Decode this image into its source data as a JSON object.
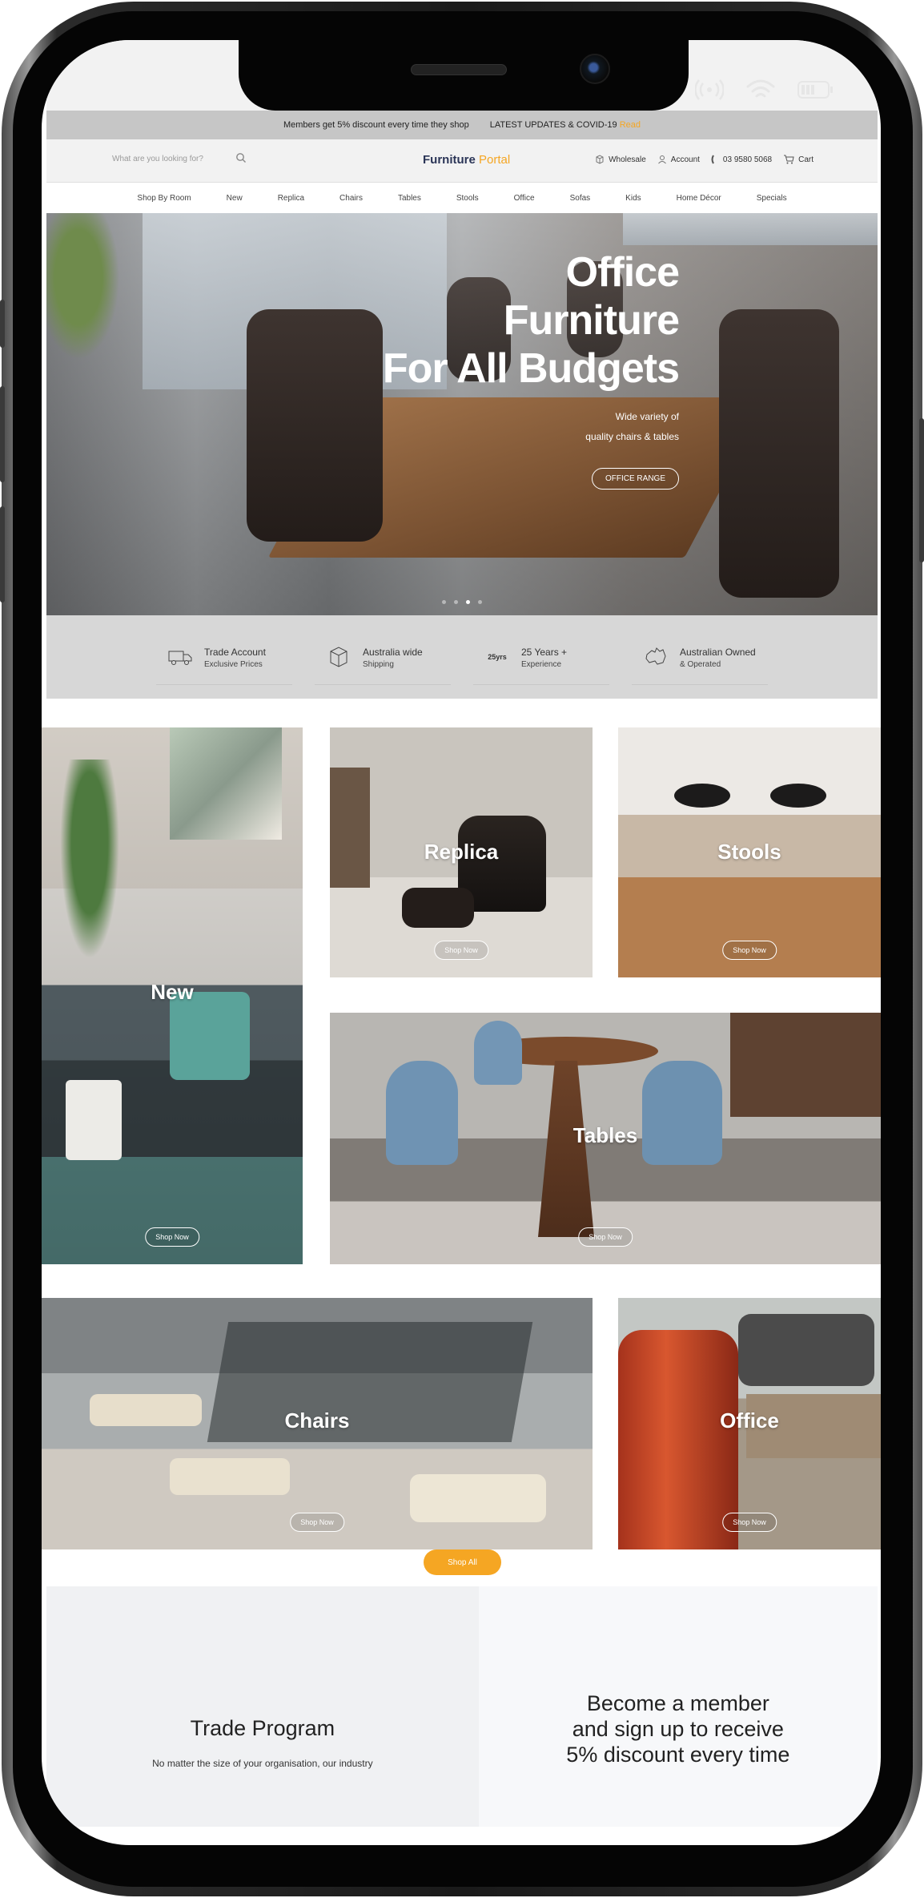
{
  "announcement": {
    "discount_text": "Members get 5% discount every time they shop",
    "updates_text": "LATEST UPDATES & COVID-19",
    "updates_link": "Read"
  },
  "header": {
    "search_placeholder": "What are you looking for?",
    "logo_main": "Furniture",
    "logo_accent": "Portal",
    "wholesale": "Wholesale",
    "account": "Account",
    "phone": "03 9580 5068",
    "cart": "Cart"
  },
  "nav": [
    "Shop By Room",
    "New",
    "Replica",
    "Chairs",
    "Tables",
    "Stools",
    "Office",
    "Sofas",
    "Kids",
    "Home Décor",
    "Specials"
  ],
  "hero": {
    "title_line1": "Office",
    "title_line2": "Furniture",
    "title_line3": "For All Budgets",
    "sub_line1": "Wide variety of",
    "sub_line2": "quality chairs & tables",
    "button": "OFFICE RANGE",
    "slides": 4,
    "active_slide": 3
  },
  "features": [
    {
      "title": "Trade Account",
      "subtitle": "Exclusive Prices",
      "icon": "van-icon"
    },
    {
      "title": "Australia wide",
      "subtitle": "Shipping",
      "icon": "box-icon"
    },
    {
      "title": "25 Years +",
      "subtitle": "Experience",
      "icon": "25yrs-badge-icon",
      "badge": "25yrs"
    },
    {
      "title": "Australian Owned",
      "subtitle": "& Operated",
      "icon": "australia-map-icon"
    }
  ],
  "categories": {
    "new": {
      "title": "New",
      "button": "Shop Now"
    },
    "replica": {
      "title": "Replica",
      "button": "Shop Now"
    },
    "stools": {
      "title": "Stools",
      "button": "Shop Now"
    },
    "tables": {
      "title": "Tables",
      "button": "Shop Now"
    },
    "chairs": {
      "title": "Chairs",
      "button": "Shop Now"
    },
    "office": {
      "title": "Office",
      "button": "Shop Now"
    }
  },
  "shop_all": "Shop All",
  "trade": {
    "title": "Trade Program",
    "text": "No matter the size of your organisation, our industry"
  },
  "member": {
    "line1": "Become a member",
    "line2": "and sign up to receive",
    "line3": "5% discount every time"
  },
  "colors": {
    "accent": "#f5a623",
    "brand": "#2b3557"
  }
}
